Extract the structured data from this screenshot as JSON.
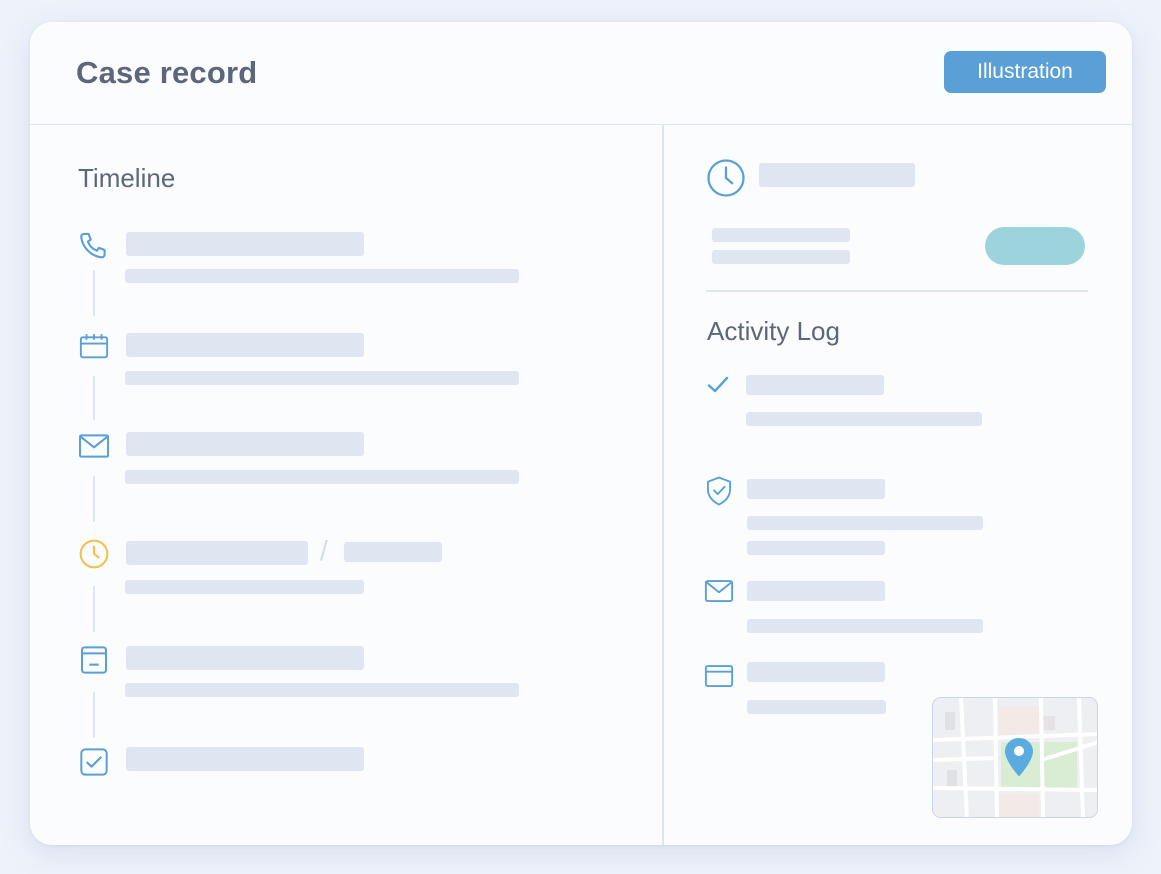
{
  "header": {
    "title": "Case record",
    "badge": "Illustration"
  },
  "timeline": {
    "title": "Timeline",
    "items": [
      {
        "icon": "phone-icon"
      },
      {
        "icon": "calendar-icon"
      },
      {
        "icon": "mail-icon"
      },
      {
        "icon": "clock-icon"
      },
      {
        "icon": "document-icon"
      },
      {
        "icon": "checkbox-icon"
      }
    ],
    "separator": "/"
  },
  "activity": {
    "title": "Activity Log",
    "items": [
      {
        "icon": "check-icon"
      },
      {
        "icon": "shield-check-icon"
      },
      {
        "icon": "mail-icon"
      },
      {
        "icon": "browser-window-icon"
      }
    ]
  },
  "colors": {
    "accent": "#5a9fd6",
    "pill": "#9dd4dc",
    "placeholder": "#dfe6f1",
    "clock_highlight": "#f2c14e",
    "map_pin": "#5aace0"
  }
}
